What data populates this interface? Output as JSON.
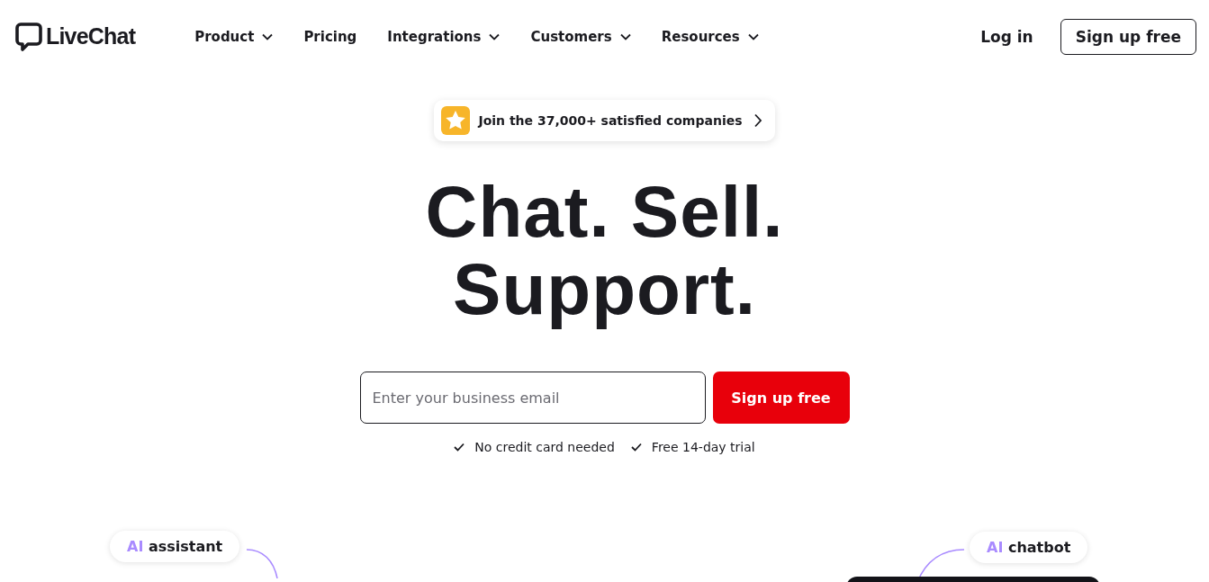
{
  "header": {
    "logo": "LiveChat",
    "nav": [
      {
        "label": "Product",
        "has_menu": true
      },
      {
        "label": "Pricing",
        "has_menu": false
      },
      {
        "label": "Integrations",
        "has_menu": true
      },
      {
        "label": "Customers",
        "has_menu": true
      },
      {
        "label": "Resources",
        "has_menu": true
      }
    ],
    "login": "Log in",
    "signup": "Sign up free"
  },
  "hero": {
    "badge": "Join the 37,000+ satisfied companies",
    "headline": [
      "Chat. Sell.",
      "Support."
    ],
    "email": {
      "placeholder": "Enter your business email"
    },
    "cta": "Sign up free",
    "perks": [
      "No credit card needed",
      "Free 14-day trial"
    ]
  },
  "features": [
    {
      "prefix": "AI",
      "label": "assistant"
    },
    {
      "prefix": "AI",
      "label": "chatbot"
    }
  ]
}
